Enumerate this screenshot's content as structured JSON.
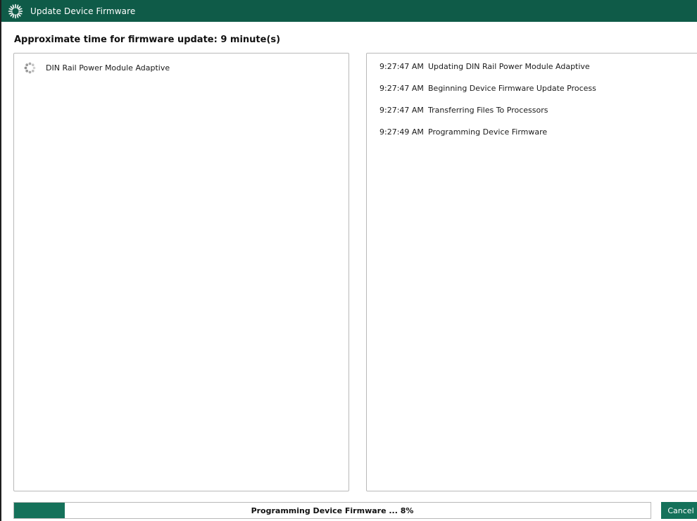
{
  "window": {
    "title": "Update Device Firmware",
    "title_icon": "spinner-burst-icon"
  },
  "estimate": {
    "text": "Approximate time for firmware update: 9 minute(s)"
  },
  "devices": [
    {
      "icon": "loading-spinner-icon",
      "name": "DIN Rail Power Module Adaptive"
    }
  ],
  "log": [
    {
      "time": "9:27:47 AM",
      "message": "Updating DIN Rail Power Module Adaptive"
    },
    {
      "time": "9:27:47 AM",
      "message": "Beginning Device Firmware Update Process"
    },
    {
      "time": "9:27:47 AM",
      "message": "Transferring Files To Processors"
    },
    {
      "time": "9:27:49 AM",
      "message": "Programming Device Firmware"
    }
  ],
  "progress": {
    "label": "Programming Device Firmware  ... 8%",
    "percent": 8
  },
  "buttons": {
    "cancel": "Cancel"
  },
  "colors": {
    "title_bar": "#0f5b48",
    "accent": "#15715a",
    "border": "#b9b9b9"
  }
}
